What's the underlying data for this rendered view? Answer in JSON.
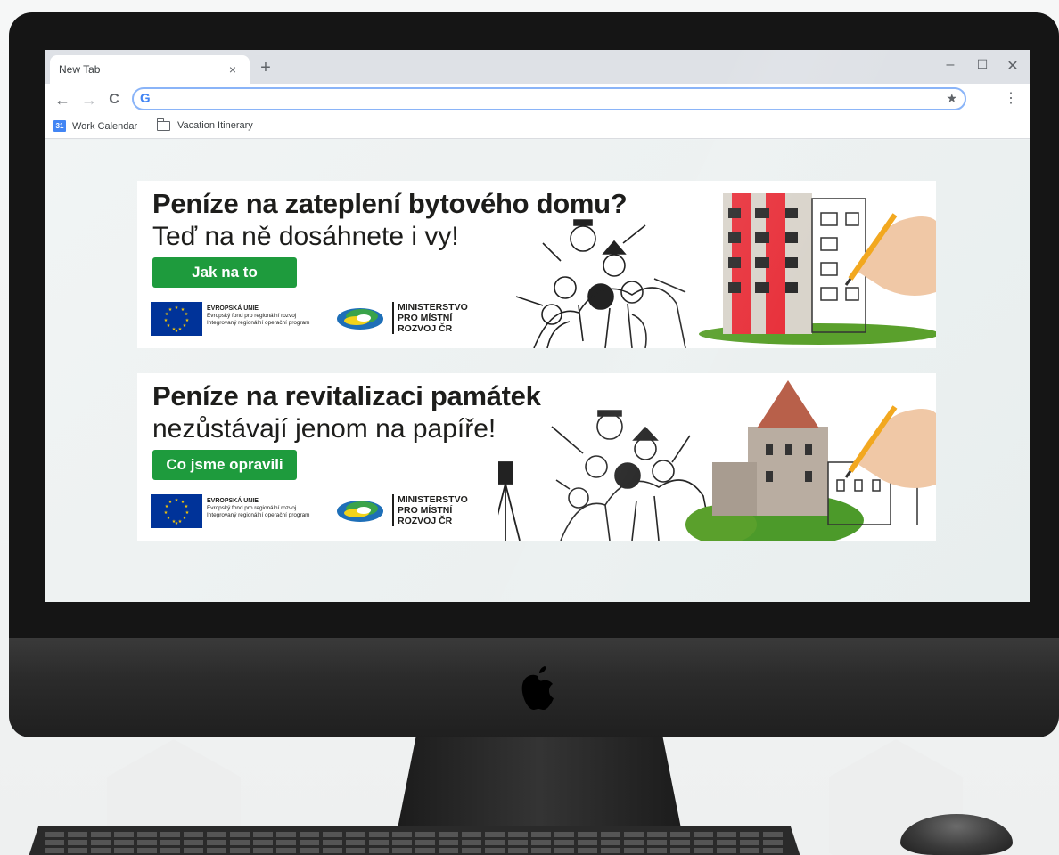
{
  "browser": {
    "tab": {
      "title": "New Tab",
      "close": "×"
    },
    "new_tab": "+",
    "window_controls": {
      "minimize": "–",
      "maximize": "☐",
      "close": "✕"
    },
    "nav": {
      "back": "←",
      "forward": "→",
      "reload": "C"
    },
    "omnibox": {
      "value": "",
      "placeholder": "",
      "icon": "google-g-icon"
    },
    "bookmarks": [
      {
        "label": "Work Calendar",
        "icon": "calendar-icon",
        "badge": "31"
      },
      {
        "label": "Vacation Itinerary",
        "icon": "folder-icon"
      }
    ]
  },
  "banners": [
    {
      "title": "Peníze na zateplení bytového domu?",
      "subtitle": "Teď na ně dosáhnete i vy!",
      "cta": "Jak na to",
      "eu": {
        "name": "EVROPSKÁ UNIE",
        "line1": "Evropský fond pro regionální rozvoj",
        "line2": "Integrovaný regionální operační program"
      },
      "ministry": [
        "MINISTERSTVO",
        "PRO MÍSTNÍ",
        "ROZVOJ ČR"
      ]
    },
    {
      "title": "Peníze na revitalizaci památek",
      "subtitle": "nezůstávají jenom na papíře!",
      "cta": "Co jsme opravili",
      "eu": {
        "name": "EVROPSKÁ UNIE",
        "line1": "Evropský fond pro regionální rozvoj",
        "line2": "Integrovaný regionální operační program"
      },
      "ministry": [
        "MINISTERSTVO",
        "PRO MÍSTNÍ",
        "ROZVOJ ČR"
      ]
    }
  ],
  "colors": {
    "cta_green": "#1e9b3d",
    "eu_blue": "#003399",
    "building_red": "#e8323c",
    "omnibox_focus": "#8ab4f8"
  }
}
